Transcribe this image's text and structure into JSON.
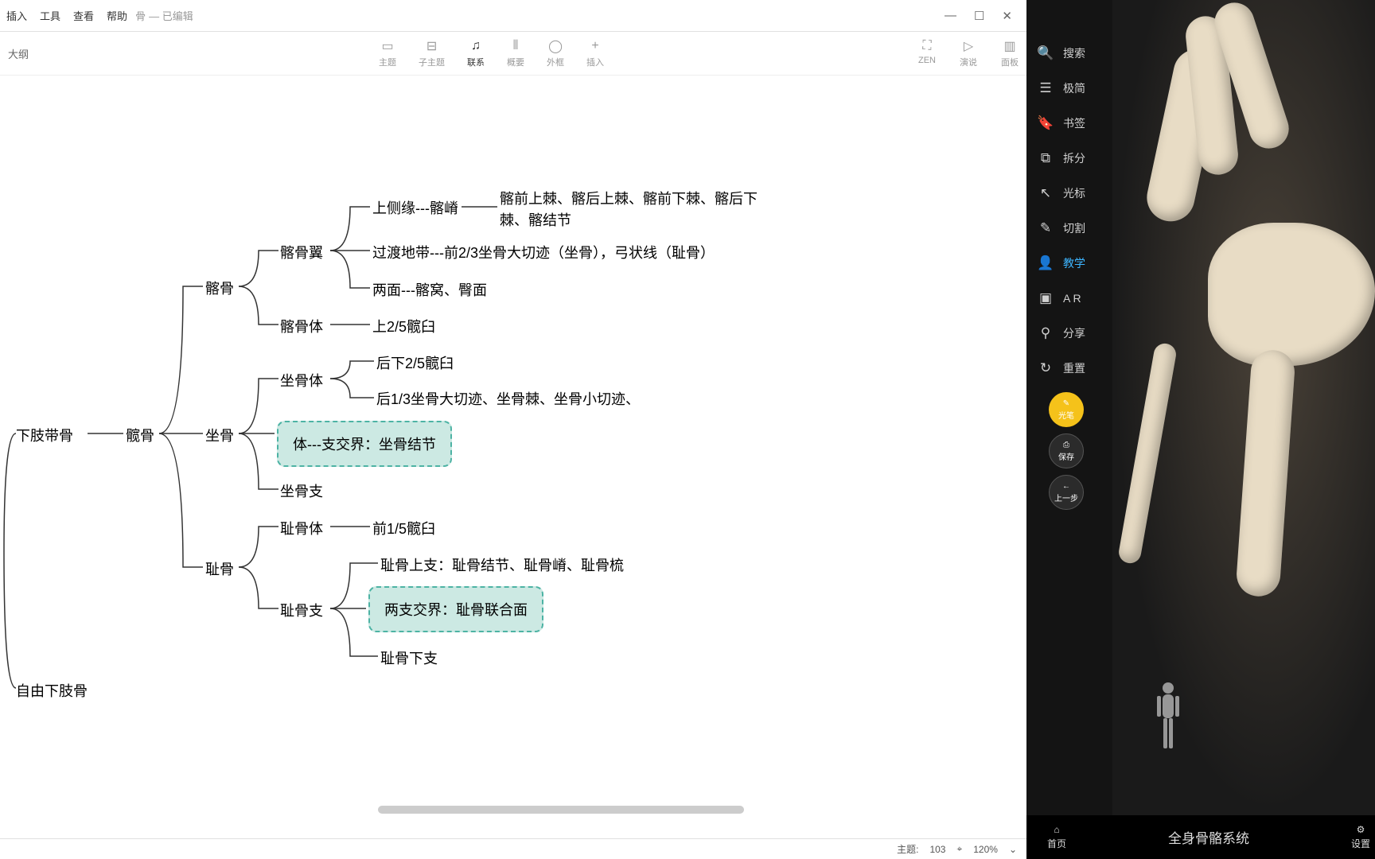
{
  "menu": {
    "insert": "插入",
    "tools": "工具",
    "view": "查看",
    "help": "帮助",
    "doc_prefix": "骨",
    "doc_state": "— 已编辑"
  },
  "outline_label": "大纲",
  "toolbar": {
    "topic": "主题",
    "subtopic": "子主题",
    "relation": "联系",
    "summary": "概要",
    "boundary": "外框",
    "insert": "插入",
    "zen": "ZEN",
    "present": "演说",
    "panel": "面板"
  },
  "statusbar": {
    "count_label": "主题:",
    "count": "103",
    "zoom": "120%"
  },
  "mindmap": {
    "root": "下肢带骨",
    "free": "自由下肢骨",
    "hip": "髋骨",
    "ilium": "髂骨",
    "ilium_wing": "髂骨翼",
    "ilium_body": "髂骨体",
    "ilium_w1": "上侧缘---髂嵴",
    "ilium_w1_detail": "髂前上棘、髂后上棘、髂前下棘、髂后下棘、髂结节",
    "ilium_w2": "过渡地带---前2/3坐骨大切迹（坐骨），弓状线（耻骨）",
    "ilium_w3": "两面---髂窝、臀面",
    "ilium_body_detail": "上2/5髋臼",
    "ischium": "坐骨",
    "ischium_body": "坐骨体",
    "ischium_b1": "后下2/5髋臼",
    "ischium_b2": "后1/3坐骨大切迹、坐骨棘、坐骨小切迹、",
    "ischium_hl": "体---支交界：坐骨结节",
    "ischium_ramus": "坐骨支",
    "pubis": "耻骨",
    "pubis_body": "耻骨体",
    "pubis_body_detail": "前1/5髋臼",
    "pubis_ramus": "耻骨支",
    "pubis_sup": "耻骨上支：耻骨结节、耻骨嵴、耻骨梳",
    "pubis_hl": "两支交界：耻骨联合面",
    "pubis_inf": "耻骨下支"
  },
  "side": {
    "search": "搜索",
    "simple": "极简",
    "bookmark": "书签",
    "split": "拆分",
    "cursor": "光标",
    "cut": "切割",
    "teach": "教学",
    "ar": "A R",
    "share": "分享",
    "reset": "重置",
    "pen": "光笔",
    "save": "保存",
    "prev": "上一步"
  },
  "right_bottom": {
    "home": "首页",
    "title": "全身骨骼系统",
    "settings": "设置"
  }
}
